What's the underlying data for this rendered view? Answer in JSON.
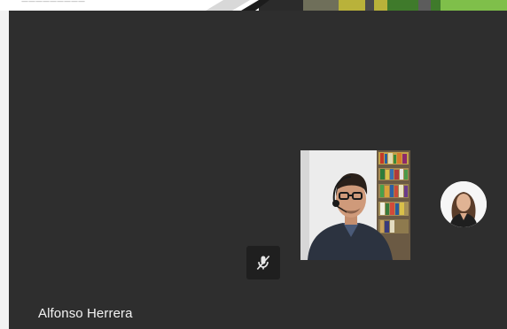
{
  "shared_content": {
    "caption": "—————————",
    "colors": [
      "#2b2b2b",
      "#6f6f5a",
      "#b9b23a",
      "#3f7a2b",
      "#7fbf4a"
    ]
  },
  "stage": {
    "background": "#2e2e2e"
  },
  "main_participant": {
    "name": "Alfonso Herrera",
    "mic_state": "muted",
    "mic_icon": "mic-off-icon"
  },
  "self_view": {
    "video": true
  },
  "other_participant": {
    "avatar_icon": "avatar"
  }
}
